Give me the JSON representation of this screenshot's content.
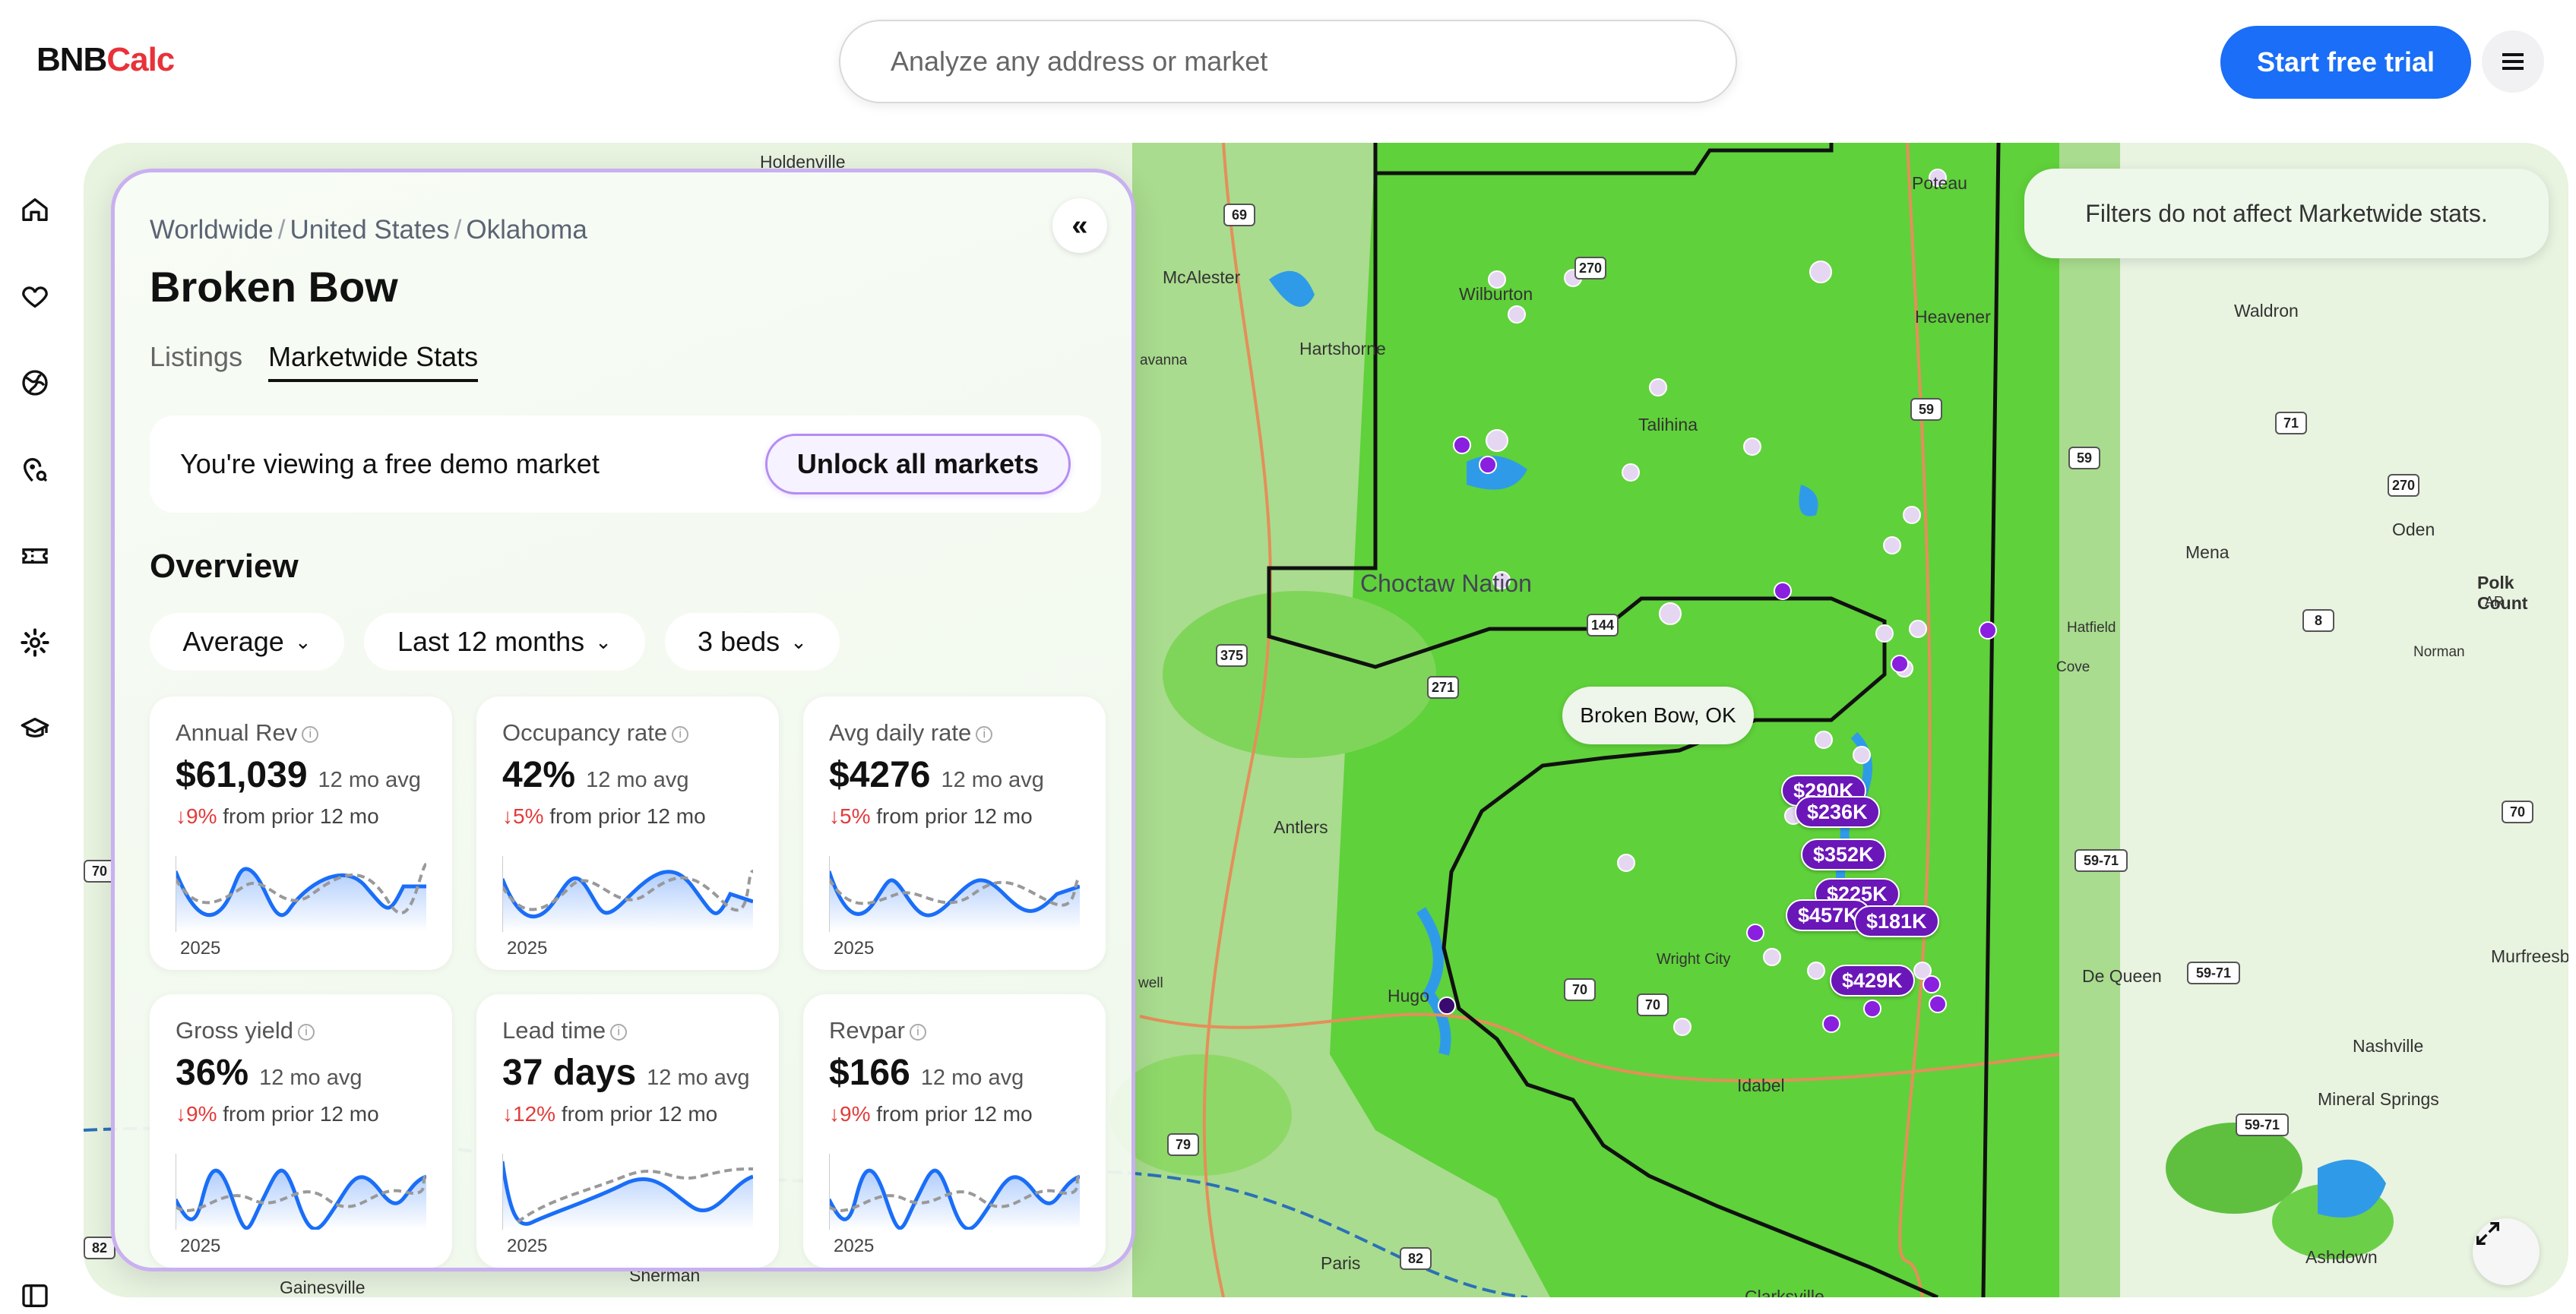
{
  "header": {
    "logo_part1": "BNB",
    "logo_part2": "Calc",
    "search_placeholder": "Analyze any address or market",
    "trial_label": "Start free trial"
  },
  "panel": {
    "breadcrumb": [
      "Worldwide",
      "United States",
      "Oklahoma"
    ],
    "title": "Broken Bow",
    "tabs": [
      {
        "label": "Listings"
      },
      {
        "label": "Marketwide Stats"
      }
    ],
    "demo_text": "You're viewing a free demo market",
    "unlock_label": "Unlock all markets",
    "overview": "Overview",
    "filters": [
      "Average",
      "Last 12 months",
      "3 beds"
    ],
    "metrics": [
      {
        "label": "Annual Rev",
        "value": "$61,039",
        "avg": "12 mo avg",
        "change": "↓9%",
        "change_text": "from prior 12 mo",
        "year": "2025"
      },
      {
        "label": "Occupancy rate",
        "value": "42%",
        "avg": "12 mo avg",
        "change": "↓5%",
        "change_text": "from prior 12 mo",
        "year": "2025"
      },
      {
        "label": "Avg daily rate",
        "value": "$4276",
        "avg": "12 mo avg",
        "change": "↓5%",
        "change_text": "from prior 12 mo",
        "year": "2025"
      },
      {
        "label": "Gross yield",
        "value": "36%",
        "avg": "12 mo avg",
        "change": "↓9%",
        "change_text": "from prior 12 mo",
        "year": "2025"
      },
      {
        "label": "Lead time",
        "value": "37 days",
        "avg": "12 mo avg",
        "change": "↓12%",
        "change_text": "from prior 12 mo",
        "year": "2025"
      },
      {
        "label": "Revpar",
        "value": "$166",
        "avg": "12 mo avg",
        "change": "↓9%",
        "change_text": "from prior 12 mo",
        "year": "2025"
      }
    ]
  },
  "map": {
    "filter_note": "Filters do not affect Marketwide stats.",
    "market_label": "Broken Bow, OK",
    "region_label": "Choctaw Nation",
    "towns": [
      "Holdenville",
      "McAlester",
      "Wilburton",
      "Hartshorne",
      "Talihina",
      "Poteau",
      "Heavener",
      "Waldron",
      "Mena",
      "Oden",
      "Polk Count",
      "AR",
      "Hatfield",
      "Cove",
      "Norman",
      "Antlers",
      "Hugo",
      "Wright City",
      "Idabel",
      "De Queen",
      "Murfreesbo",
      "Nashville",
      "Mineral Springs",
      "Ashdown",
      "Paris",
      "Clarksville",
      "Gainesville",
      "Sherman",
      "avanna",
      "well"
    ],
    "pins": [
      "$290K",
      "$236K",
      "$352K",
      "$225K",
      "$457K",
      "$181K",
      "$429K"
    ],
    "shields": [
      "69",
      "270",
      "59",
      "144",
      "375",
      "271",
      "70",
      "70",
      "79",
      "82",
      "71",
      "270",
      "59",
      "8",
      "70",
      "59-71",
      "59-71",
      "59-71",
      "70",
      "82"
    ],
    "colors": {
      "accent": "#1a6ef7",
      "pin": "#6a16b8",
      "logo_red": "#e8323a",
      "market_green": "#5fd13a"
    }
  },
  "rail_icons": [
    "home-icon",
    "heart-icon",
    "globe-icon",
    "location-search-icon",
    "ticket-icon",
    "gear-icon",
    "graduation-cap-icon",
    "sidebar-toggle-icon"
  ]
}
